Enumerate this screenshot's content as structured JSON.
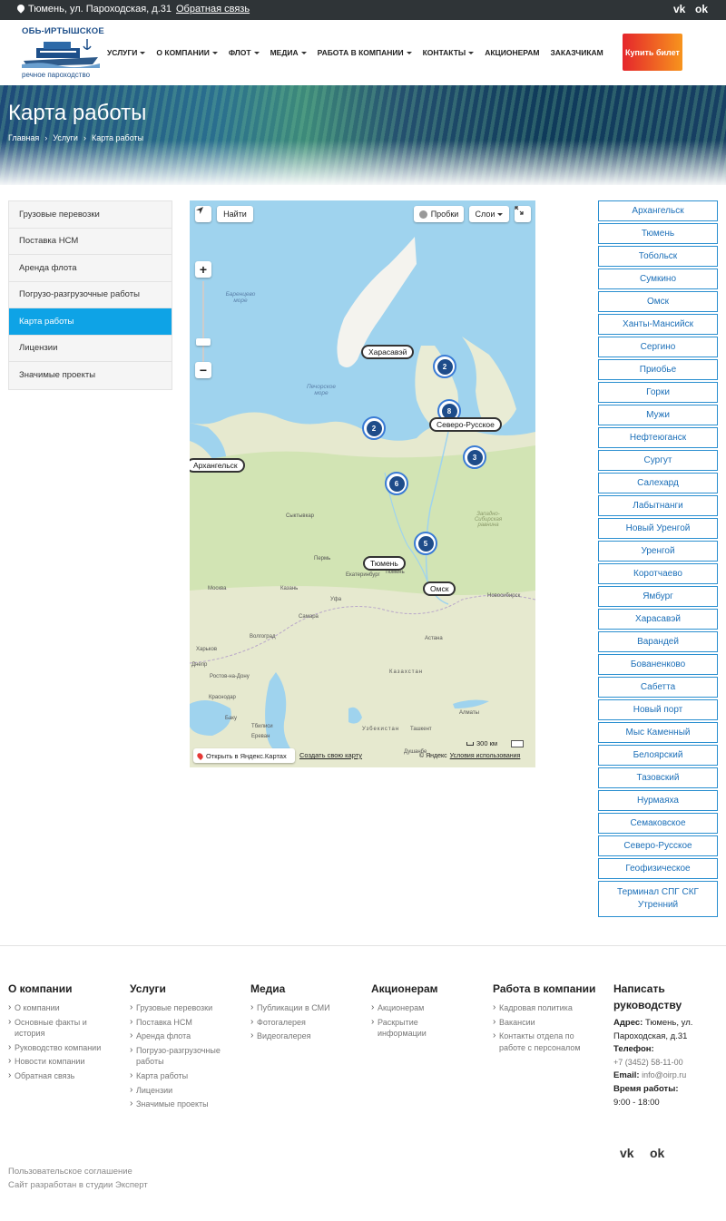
{
  "topbar": {
    "address": "Тюмень, ул. Пароходская, д.31",
    "feedback": "Обратная связь",
    "vk": "vk",
    "ok": "ok"
  },
  "logo": {
    "line1": "ОБЬ-ИРТЫШСКОЕ",
    "line2": "речное пароходство"
  },
  "nav": {
    "items": [
      "УСЛУГИ",
      "О КОМПАНИИ",
      "ФЛОТ",
      "МЕДИА",
      "РАБОТА В КОМПАНИИ",
      "КОНТАКТЫ",
      "АКЦИОНЕРАМ",
      "ЗАКАЗЧИКАМ"
    ],
    "buy": "Купить билет"
  },
  "hero": {
    "title": "Карта работы",
    "crumbs": [
      "Главная",
      "Услуги",
      "Карта работы"
    ],
    "sep": "›"
  },
  "sidebar": {
    "items": [
      "Грузовые перевозки",
      "Поставка НСМ",
      "Аренда флота",
      "Погрузо-разгрузочные работы",
      "Карта работы",
      "Лицензии",
      "Значимые проекты"
    ],
    "active_index": 4
  },
  "map": {
    "find": "Найти",
    "traffic": "Пробки",
    "layers": "Слои",
    "zoom_in": "+",
    "zoom_out": "−",
    "open_yandex": "Открыть в Яндекс.Картах",
    "create_map": "Создать свою карту",
    "copyright": "© Яндекс",
    "terms": "Условия использования",
    "scale": "300 км",
    "clusters": [
      "2",
      "8",
      "2",
      "3",
      "6",
      "5"
    ],
    "labels": [
      "Харасавэй",
      "Северо-Русское",
      "Архангельск",
      "Тюмень",
      "Омск"
    ],
    "seas": [
      "Баренцево море",
      "Печорское море"
    ],
    "places": [
      "Сыктывкар",
      "Пермь",
      "Екатеринбург",
      "Тюмень",
      "Москва",
      "Казань",
      "Уфа",
      "Самара",
      "Волгоград",
      "Харьков",
      "Днепр",
      "Ростов-на-Дону",
      "Краснодар",
      "Тбилиси",
      "Ереван",
      "Баку",
      "Новосибирск",
      "Астана",
      "Алматы",
      "Ташкент",
      "Душанбе",
      "Казахстан",
      "Узбекистан",
      "Западно-Сибирская равнина"
    ]
  },
  "cities": [
    "Архангельск",
    "Тюмень",
    "Тобольск",
    "Сумкино",
    "Омск",
    "Ханты-Мансийск",
    "Сергино",
    "Приобье",
    "Горки",
    "Мужи",
    "Нефтеюганск",
    "Сургут",
    "Салехард",
    "Лабытнанги",
    "Новый Уренгой",
    "Уренгой",
    "Коротчаево",
    "Ямбург",
    "Харасавэй",
    "Варандей",
    "Бованенково",
    "Сабетта",
    "Новый порт",
    "Мыс Каменный",
    "Белоярский",
    "Тазовский",
    "Нурмаяха",
    "Семаковское",
    "Северо-Русское",
    "Геофизическое",
    "Терминал СПГ СКГ Утренний"
  ],
  "footer": {
    "col1": {
      "title": "О компании",
      "links": [
        "О компании",
        "Основные факты и история",
        "Руководство компании",
        "Новости компании",
        "Обратная связь"
      ]
    },
    "col2": {
      "title": "Услуги",
      "links": [
        "Грузовые перевозки",
        "Поставка НСМ",
        "Аренда флота",
        "Погрузо-разгрузочные работы",
        "Карта работы",
        "Лицензии",
        "Значимые проекты"
      ]
    },
    "col3": {
      "title": "Медиа",
      "links": [
        "Публикации в СМИ",
        "Фотогалерея",
        "Видеогалерея"
      ]
    },
    "col4": {
      "title": "Акционерам",
      "links": [
        "Акционерам",
        "Раскрытие информации"
      ]
    },
    "col5": {
      "title": "Работа в компании",
      "links": [
        "Кадровая политика",
        "Вакансии",
        "Контакты отдела по работе с персоналом"
      ]
    },
    "contact": {
      "title": "Написать руководству",
      "address_label": "Адрес:",
      "address": "Тюмень, ул. Пароходская, д.31",
      "phone_label": "Телефон:",
      "phone": "+7 (3452) 58-11-00",
      "email_label": "Email:",
      "email": "info@oirp.ru",
      "hours_label": "Время работы:",
      "hours": "9:00 - 18:00"
    },
    "agreement": "Пользовательское соглашение",
    "dev": "Сайт разработан в студии Эксперт"
  }
}
